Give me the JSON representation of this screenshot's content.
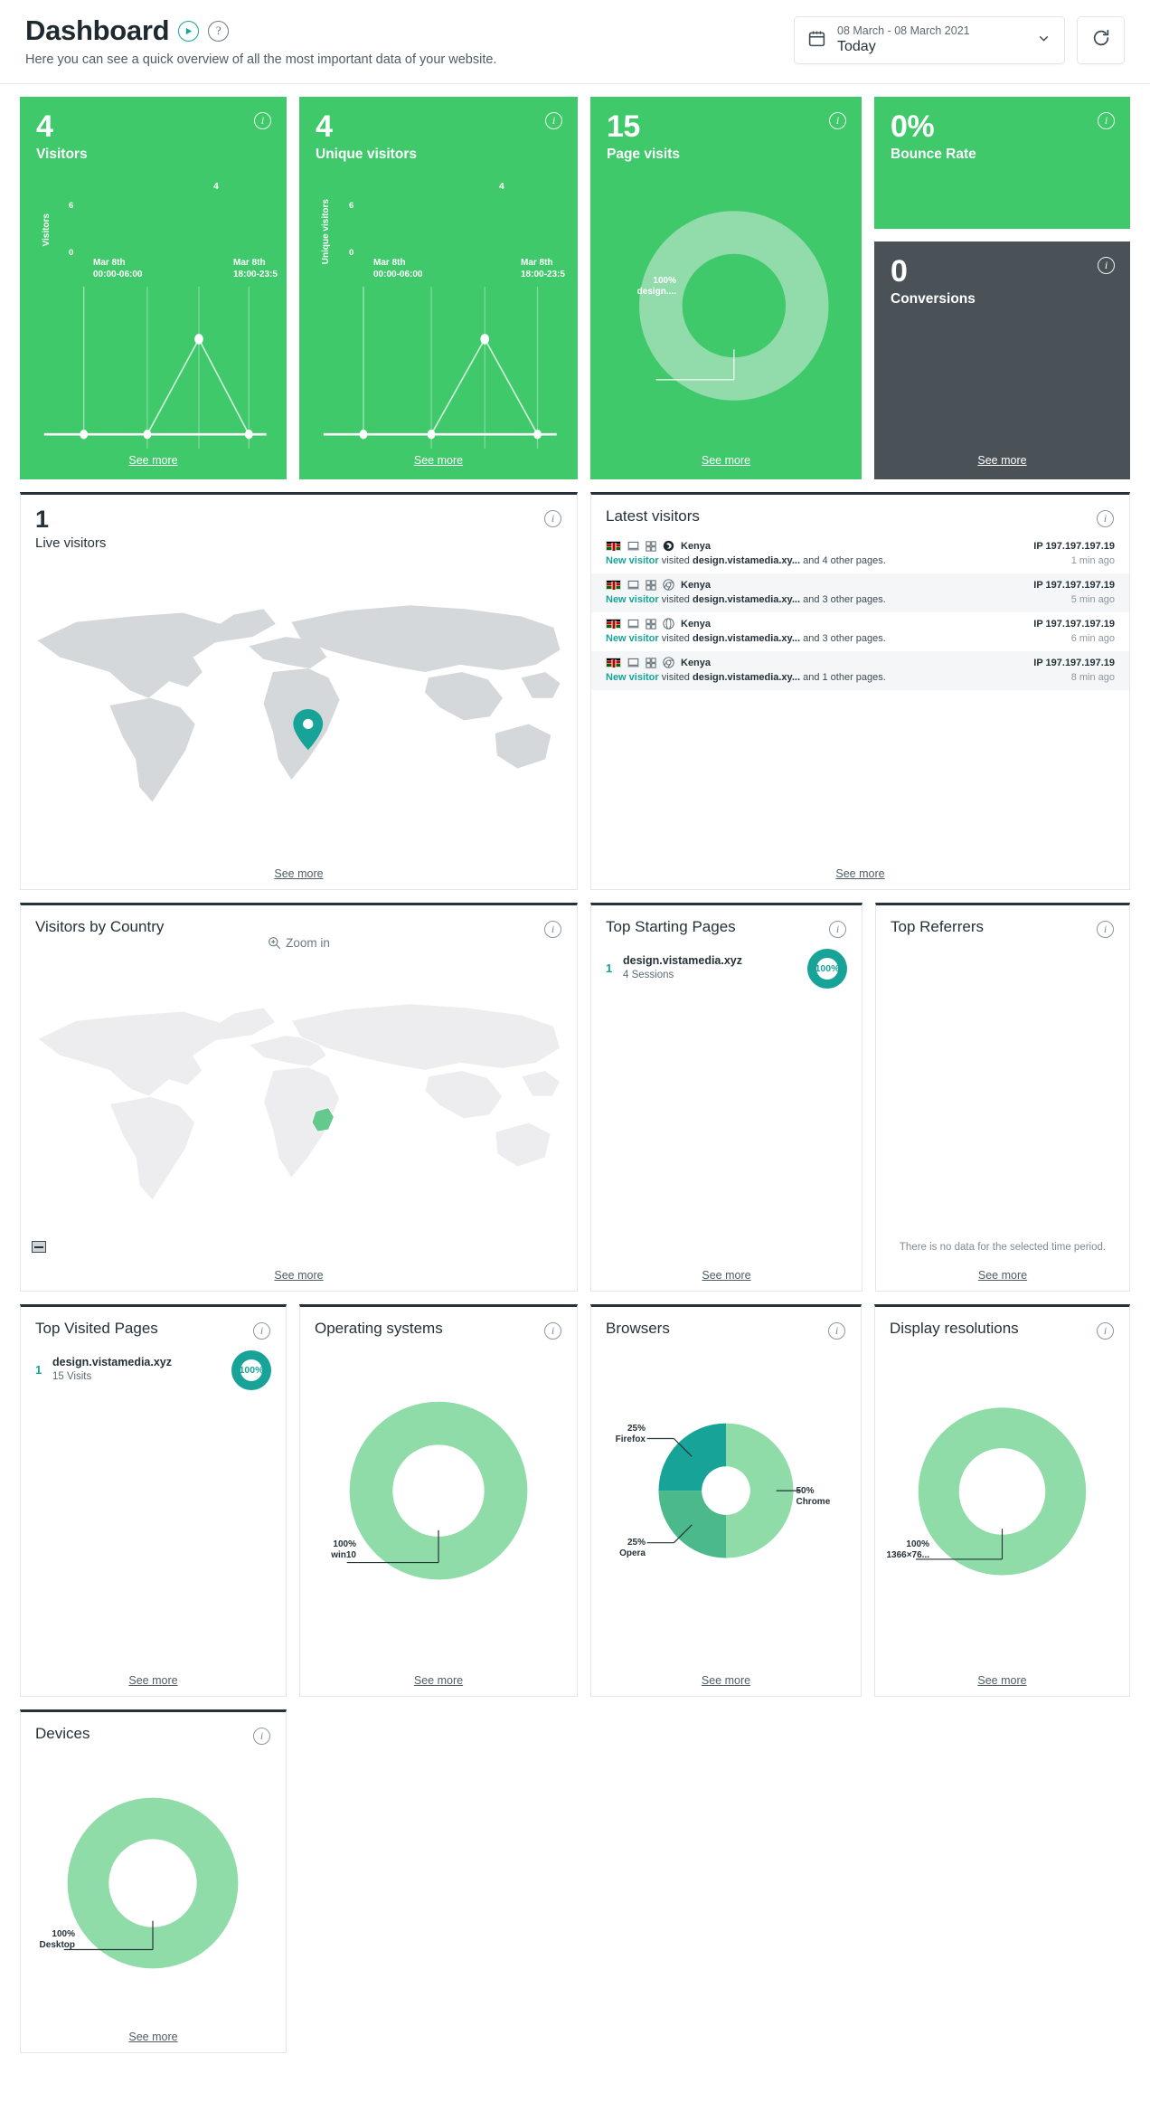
{
  "header": {
    "title": "Dashboard",
    "subtitle": "Here you can see a quick overview of all the most important data of your website.",
    "play_icon": "play-circle-icon",
    "help_icon": "help-circle-icon",
    "datepicker": {
      "calendar_icon": "calendar-icon",
      "range": "08 March - 08 March 2021",
      "label": "Today",
      "chevron_icon": "chevron-down-icon"
    },
    "refresh_icon": "refresh-icon"
  },
  "common": {
    "see_more": "See more",
    "info_icon": "info-icon"
  },
  "kpis": [
    {
      "value": "4",
      "label": "Visitors"
    },
    {
      "value": "4",
      "label": "Unique visitors"
    },
    {
      "value": "15",
      "label": "Page visits"
    },
    {
      "value": "0%",
      "label": "Bounce Rate"
    },
    {
      "value": "0",
      "label": "Conversions"
    }
  ],
  "live_visitors": {
    "value": "1",
    "label": "Live visitors"
  },
  "latest_visitors": {
    "title": "Latest visitors",
    "rows": [
      {
        "country": "Kenya",
        "status": "New visitor",
        "verb": "visited",
        "page": "design.vistamedia.xy...",
        "tail": "and 4 other pages.",
        "ip": "IP 197.197.197.19",
        "time": "1 min ago",
        "browser_icon": "firefox-icon",
        "device_icon": "desktop-icon",
        "os_icon": "windows-icon"
      },
      {
        "country": "Kenya",
        "status": "New visitor",
        "verb": "visited",
        "page": "design.vistamedia.xy...",
        "tail": "and 3 other pages.",
        "ip": "IP 197.197.197.19",
        "time": "5 min ago",
        "browser_icon": "chrome-icon",
        "device_icon": "desktop-icon",
        "os_icon": "windows-icon"
      },
      {
        "country": "Kenya",
        "status": "New visitor",
        "verb": "visited",
        "page": "design.vistamedia.xy...",
        "tail": "and 3 other pages.",
        "ip": "IP 197.197.197.19",
        "time": "6 min ago",
        "browser_icon": "opera-icon",
        "device_icon": "desktop-icon",
        "os_icon": "windows-icon"
      },
      {
        "country": "Kenya",
        "status": "New visitor",
        "verb": "visited",
        "page": "design.vistamedia.xy...",
        "tail": "and 1 other pages.",
        "ip": "IP 197.197.197.19",
        "time": "8 min ago",
        "browser_icon": "chrome-icon",
        "device_icon": "desktop-icon",
        "os_icon": "windows-icon"
      }
    ]
  },
  "visitors_by_country": {
    "title": "Visitors by Country",
    "zoom_in": "Zoom in",
    "zoom_icon": "zoom-in-icon",
    "legend_icon": "map-legend-icon"
  },
  "top_starting_pages": {
    "title": "Top Starting Pages",
    "items": [
      {
        "rank": "1",
        "name": "design.vistamedia.xyz",
        "sub": "4 Sessions",
        "percent": "100%"
      }
    ]
  },
  "top_referrers": {
    "title": "Top Referrers",
    "empty": "There is no data for the selected time period."
  },
  "top_visited_pages": {
    "title": "Top Visited Pages",
    "items": [
      {
        "rank": "1",
        "name": "design.vistamedia.xyz",
        "sub": "15 Visits",
        "percent": "100%"
      }
    ]
  },
  "operating_systems": {
    "title": "Operating systems"
  },
  "browsers": {
    "title": "Browsers"
  },
  "display_resolutions": {
    "title": "Display resolutions"
  },
  "devices": {
    "title": "Devices"
  },
  "colors": {
    "kpi_green": "#3fc96a",
    "kpi_dark": "#4a5257",
    "teal": "#17a398",
    "donut_light": "#8fdca9",
    "donut_mid": "#4cb98a",
    "donut_dark": "#17a398",
    "panel_top_border": "#263238",
    "map_land": "#d4d8da",
    "map_pin": "#17a398"
  },
  "chart_data": [
    {
      "type": "line",
      "id": "visitors-line",
      "title": "Visitors",
      "ylabel": "Visitors",
      "x": [
        "Mar 8th 00:00-06:00",
        "",
        "",
        "Mar 8th 18:00-23:5"
      ],
      "tick_labels": [
        "Mar 8th\n00:00-06:00",
        "Mar 8th\n18:00-23:5"
      ],
      "values": [
        0,
        0,
        4,
        0
      ],
      "point_labels": [
        "",
        "",
        "4",
        ""
      ],
      "ylim": [
        0,
        6
      ],
      "yticks": [
        0,
        6
      ],
      "grid": true
    },
    {
      "type": "line",
      "id": "unique-visitors-line",
      "title": "Unique visitors",
      "ylabel": "Unique visitors",
      "x": [
        "Mar 8th 00:00-06:00",
        "",
        "",
        "Mar 8th 18:00-23:5"
      ],
      "tick_labels": [
        "Mar 8th\n00:00-06:00",
        "Mar 8th\n18:00-23:5"
      ],
      "values": [
        0,
        0,
        4,
        0
      ],
      "point_labels": [
        "",
        "",
        "4",
        ""
      ],
      "ylim": [
        0,
        6
      ],
      "yticks": [
        0,
        6
      ],
      "grid": true
    },
    {
      "type": "pie",
      "id": "page-visits-donut",
      "title": "Page visits",
      "labels": [
        "design...."
      ],
      "values": [
        100
      ],
      "label_text": [
        "100%",
        "design...."
      ],
      "colors": [
        "#8fdca9"
      ]
    },
    {
      "type": "pie",
      "id": "operating-systems-donut",
      "title": "Operating systems",
      "labels": [
        "win10"
      ],
      "values": [
        100
      ],
      "label_text": [
        "100%",
        "win10"
      ],
      "colors": [
        "#8fdca9"
      ]
    },
    {
      "type": "pie",
      "id": "browsers-donut",
      "title": "Browsers",
      "labels": [
        "Chrome",
        "Opera",
        "Firefox"
      ],
      "values": [
        50,
        25,
        25
      ],
      "label_text": [
        "50%\nChrome",
        "25%\nOpera",
        "25%\nFirefox"
      ],
      "colors": [
        "#8fdca9",
        "#4cb98a",
        "#17a398"
      ]
    },
    {
      "type": "pie",
      "id": "display-resolutions-donut",
      "title": "Display resolutions",
      "labels": [
        "1366×76..."
      ],
      "values": [
        100
      ],
      "label_text": [
        "100%",
        "1366×76..."
      ],
      "colors": [
        "#8fdca9"
      ]
    },
    {
      "type": "pie",
      "id": "devices-donut",
      "title": "Devices",
      "labels": [
        "Desktop"
      ],
      "values": [
        100
      ],
      "label_text": [
        "100%",
        "Desktop"
      ],
      "colors": [
        "#8fdca9"
      ]
    }
  ]
}
